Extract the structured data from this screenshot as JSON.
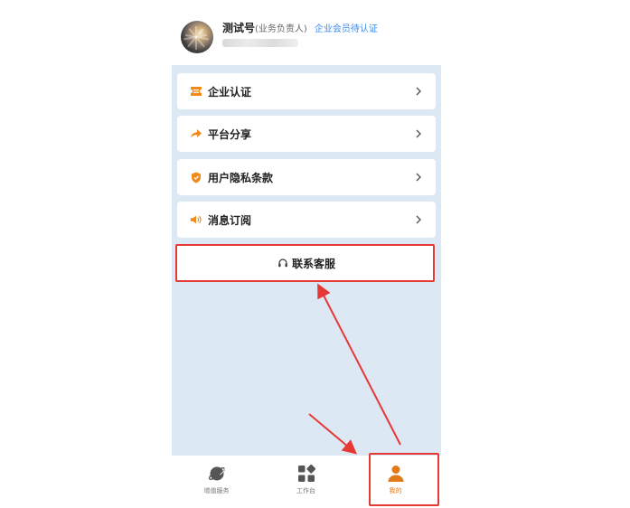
{
  "header": {
    "name": "测试号",
    "role": "(业务负责人)",
    "cert_status": "企业会员待认证"
  },
  "menu": {
    "items": [
      {
        "label": "企业认证",
        "icon": "ticket-icon"
      },
      {
        "label": "平台分享",
        "icon": "share-arrow-icon"
      },
      {
        "label": "用户隐私条款",
        "icon": "shield-icon"
      },
      {
        "label": "消息订阅",
        "icon": "speaker-icon"
      }
    ],
    "service_label": "联系客服",
    "service_icon": "headset-icon"
  },
  "tabbar": {
    "tabs": [
      {
        "label": "增值服务",
        "icon": "planet-icon"
      },
      {
        "label": "工作台",
        "icon": "grid-icon"
      },
      {
        "label": "我的",
        "icon": "user-icon",
        "active": true
      }
    ]
  },
  "colors": {
    "accent": "#e07a1b",
    "link": "#3c8be8",
    "content_bg": "#dde8f5",
    "annotation": "#e53935"
  }
}
